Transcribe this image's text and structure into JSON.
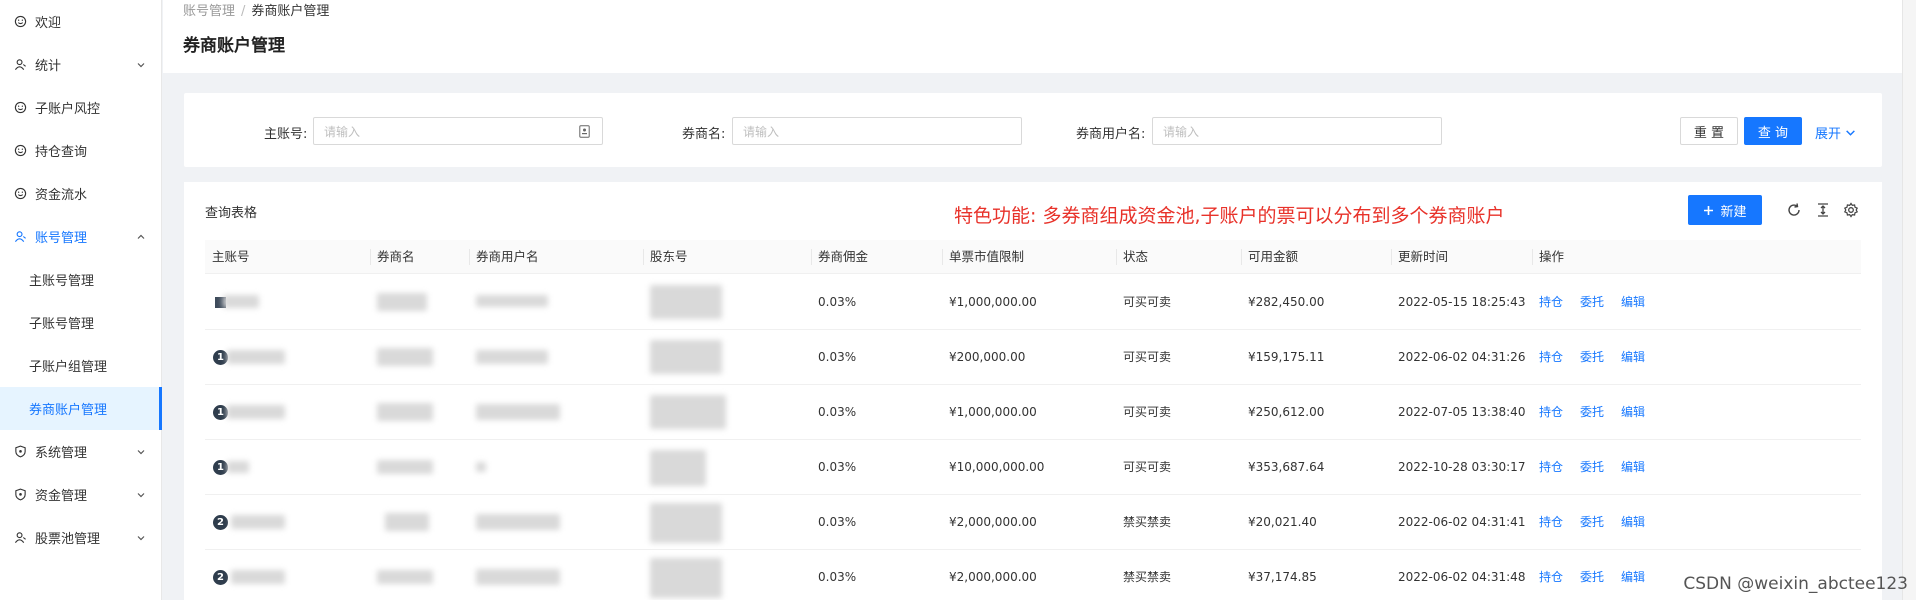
{
  "sidebar": {
    "items": [
      {
        "label": "欢迎",
        "icon": "smile-icon"
      },
      {
        "label": "统计",
        "icon": "user-stat-icon",
        "chevron": "down"
      },
      {
        "label": "子账户风控",
        "icon": "smile-icon"
      },
      {
        "label": "持仓查询",
        "icon": "smile-icon"
      },
      {
        "label": "资金流水",
        "icon": "smile-icon"
      },
      {
        "label": "账号管理",
        "icon": "user-group-icon",
        "chevron": "up",
        "active": true
      },
      {
        "label": "系统管理",
        "icon": "shield-icon",
        "chevron": "down"
      },
      {
        "label": "资金管理",
        "icon": "shield-icon",
        "chevron": "down"
      },
      {
        "label": "股票池管理",
        "icon": "user-group-icon",
        "chevron": "down"
      }
    ],
    "sub_items": [
      {
        "label": "主账号管理"
      },
      {
        "label": "子账号管理"
      },
      {
        "label": "子账户组管理"
      },
      {
        "label": "券商账户管理",
        "selected": true
      }
    ]
  },
  "header": {
    "breadcrumb": [
      "账号管理",
      "券商账户管理"
    ],
    "breadcrumb_sep": "/",
    "title": "券商账户管理"
  },
  "search": {
    "fields": [
      {
        "label": "主账号:",
        "placeholder": "请输入"
      },
      {
        "label": "券商名:",
        "placeholder": "请输入"
      },
      {
        "label": "券商用户名:",
        "placeholder": "请输入"
      }
    ],
    "reset_label": "重 置",
    "query_label": "查 询",
    "expand_label": "展开"
  },
  "table": {
    "title": "查询表格",
    "feature_note": "特色功能: 多券商组成资金池,子账户的票可以分布到多个券商账户",
    "new_label": "新建",
    "columns": [
      "主账号",
      "券商名",
      "券商用户名",
      "股东号",
      "券商佣金",
      "单票市值限制",
      "状态",
      "可用金额",
      "更新时间",
      "操作"
    ],
    "actions": [
      "持仓",
      "委托",
      "编辑"
    ],
    "rows": [
      {
        "badge": "",
        "commission": "0.03%",
        "limit": "¥1,000,000.00",
        "status": "可买可卖",
        "available": "¥282,450.00",
        "updated": "2022-05-15 18:25:43"
      },
      {
        "badge": "1",
        "commission": "0.03%",
        "limit": "¥200,000.00",
        "status": "可买可卖",
        "available": "¥159,175.11",
        "updated": "2022-06-02 04:31:26"
      },
      {
        "badge": "1",
        "commission": "0.03%",
        "limit": "¥1,000,000.00",
        "status": "可买可卖",
        "available": "¥250,612.00",
        "updated": "2022-07-05 13:38:40"
      },
      {
        "badge": "1",
        "commission": "0.03%",
        "limit": "¥10,000,000.00",
        "status": "可买可卖",
        "available": "¥353,687.64",
        "updated": "2022-10-28 03:30:17"
      },
      {
        "badge": "2",
        "commission": "0.03%",
        "limit": "¥2,000,000.00",
        "status": "禁买禁卖",
        "available": "¥20,021.40",
        "updated": "2022-06-02 04:31:41"
      },
      {
        "badge": "2",
        "commission": "0.03%",
        "limit": "¥2,000,000.00",
        "status": "禁买禁卖",
        "available": "¥37,174.85",
        "updated": "2022-06-02 04:31:48"
      }
    ]
  },
  "watermark": "CSDN @weixin_abctee123",
  "colors": {
    "primary": "#1677ff",
    "note": "#e8322a"
  }
}
